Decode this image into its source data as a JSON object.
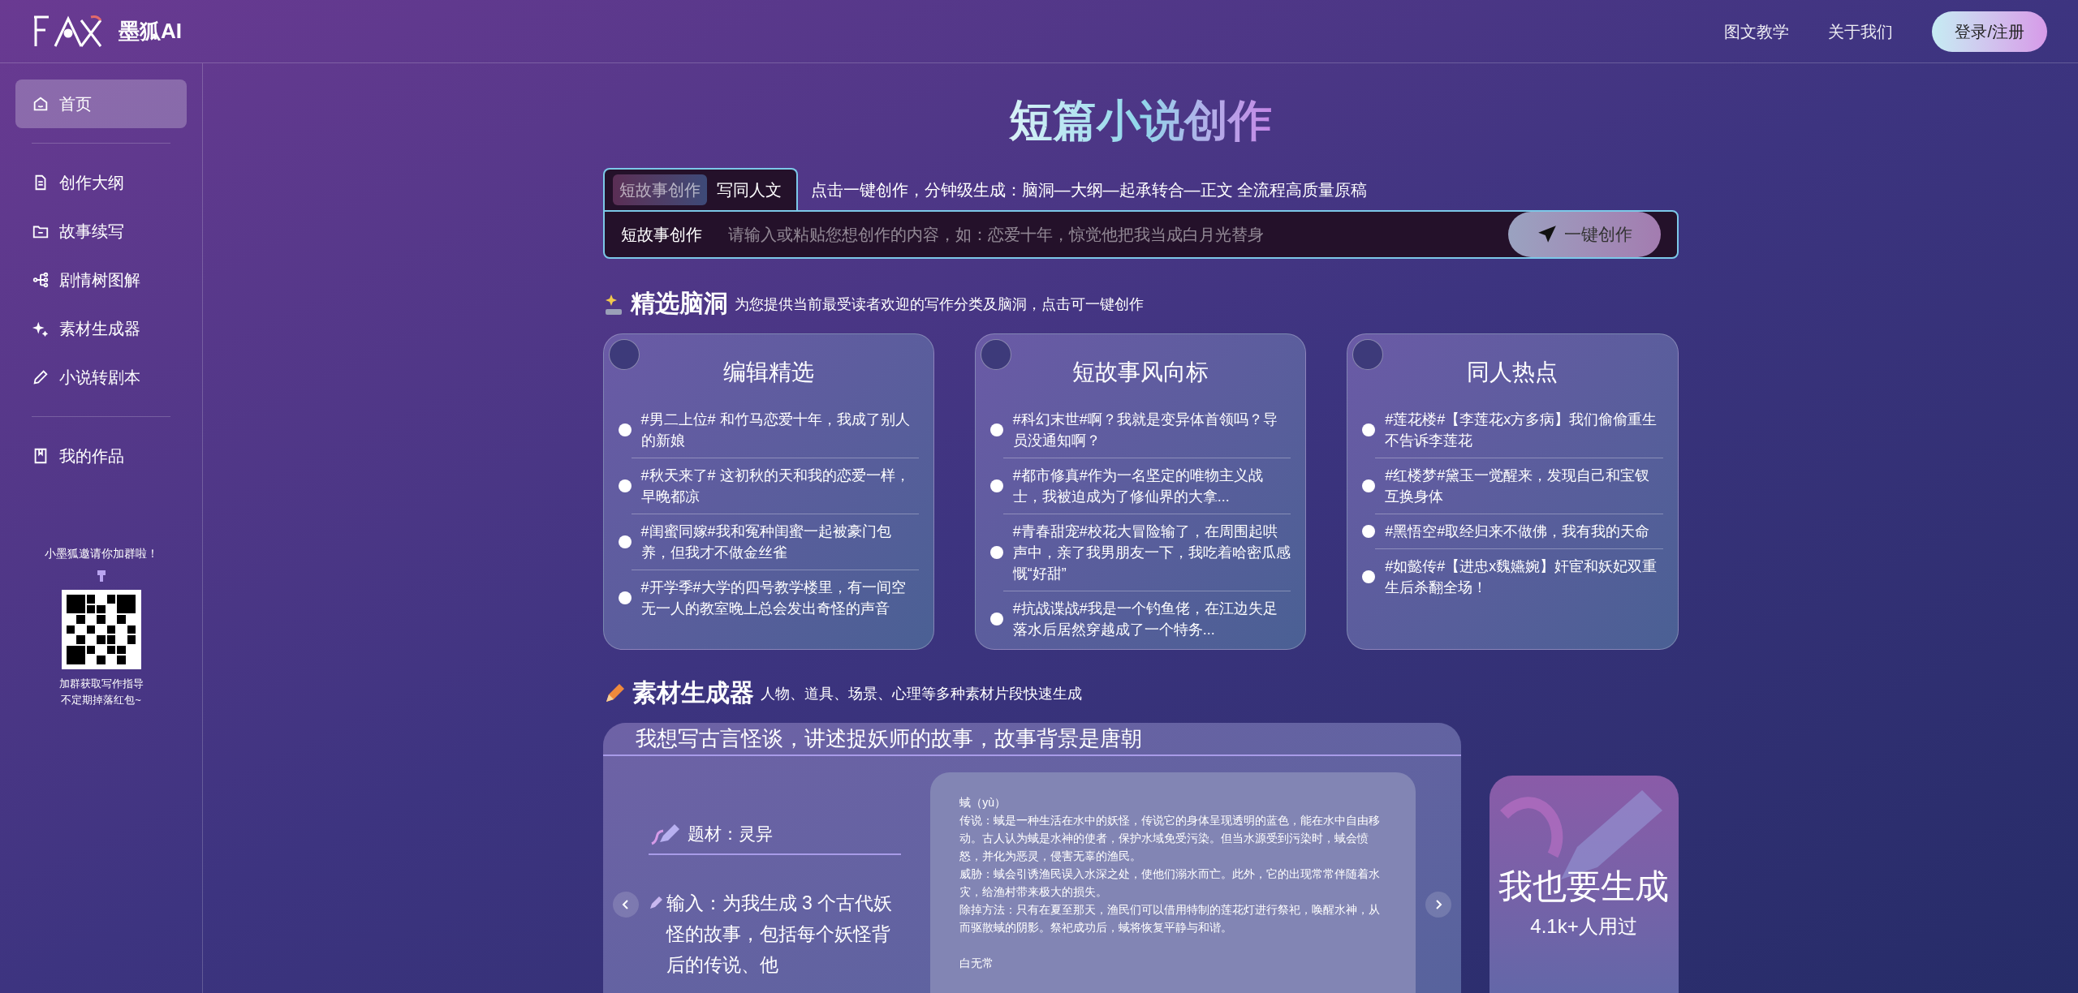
{
  "header": {
    "logo_text": "墨狐AI",
    "nav": [
      "图文教学",
      "关于我们"
    ],
    "login_button": "登录/注册"
  },
  "sidebar": {
    "groups": [
      [
        {
          "label": "首页",
          "selected": true
        }
      ],
      [
        {
          "label": "创作大纲",
          "selected": false
        },
        {
          "label": "故事续写",
          "selected": false
        },
        {
          "label": "剧情树图解",
          "selected": false
        },
        {
          "label": "素材生成器",
          "selected": false
        },
        {
          "label": "小说转剧本",
          "selected": false
        }
      ],
      [
        {
          "label": "我的作品",
          "selected": false
        }
      ]
    ],
    "invite": "小墨狐邀请你加群啦！",
    "qr_caption": [
      "加群获取写作指导",
      "不定期掉落红包~"
    ]
  },
  "main": {
    "title": "短篇小说创作",
    "tabs": [
      {
        "label": "短故事创作",
        "selected": true
      },
      {
        "label": "写同人文",
        "selected": false
      }
    ],
    "tagline": "点击一键创作，分钟级生成：脑洞—大纲—起承转合—正文 全流程高质量原稿",
    "input": {
      "label": "短故事创作",
      "placeholder": "请输入或粘贴您想创作的内容，如：恋爱十年，惊觉他把我当成白月光替身",
      "button": "一键创作"
    },
    "ideas": {
      "title": "精选脑洞",
      "subtitle": "为您提供当前最受读者欢迎的写作分类及脑洞，点击可一键创作",
      "cards": [
        {
          "title": "编辑精选",
          "items": [
            "#男二上位# 和竹马恋爱十年，我成了别人的新娘",
            "#秋天来了# 这初秋的天和我的恋爱一样，早晚都凉",
            "#闺蜜同嫁#我和冤种闺蜜一起被豪门包养，但我才不做金丝雀",
            "#开学季#大学的四号教学楼里，有一间空无一人的教室晚上总会发出奇怪的声音"
          ]
        },
        {
          "title": "短故事风向标",
          "items": [
            "#科幻末世#啊？我就是变异体首领吗？导员没通知啊？",
            "#都市修真#作为一名坚定的唯物主义战士，我被迫成为了修仙界的大拿...",
            "#青春甜宠#校花大冒险输了，在周围起哄声中，亲了我男朋友一下，我吃着哈密瓜感慨“好甜”",
            "#抗战谍战#我是一个钓鱼佬，在江边失足落水后居然穿越成了一个特务..."
          ]
        },
        {
          "title": "同人热点",
          "items": [
            "#莲花楼#【李莲花x方多病】我们偷偷重生不告诉李莲花",
            "#红楼梦#黛玉一觉醒来，发现自己和宝钗互换身体",
            "#黑悟空#取经归来不做佛，我有我的天命",
            "#如懿传#【进忠x魏嬿婉】奸宦和妖妃双重生后杀翻全场！"
          ]
        }
      ]
    },
    "materials": {
      "title": "素材生成器",
      "subtitle": "人物、道具、场景、心理等多种素材片段快速生成",
      "prompt": "我想写古言怪谈，讲述捉妖师的故事，故事背景是唐朝",
      "topic": "题材：灵异",
      "input_text": "输入：为我生成 3 个古代妖怪的故事，包括每个妖怪背后的传说、他",
      "output": [
        "蜮（yù）",
        "传说：蜮是一种生活在水中的妖怪，传说它的身体呈现透明的蓝色，能在水中自由移动。古人认为蜮是水神的使者，保护水域免受污染。但当水源受到污染时，蜮会愤怒，并化为恶灵，侵害无辜的渔民。",
        "威胁：蜮会引诱渔民误入水深之处，使他们溺水而亡。此外，它的出现常常伴随着水灾，给渔村带来极大的损失。",
        "除掉方法：只有在夏至那天，渔民们可以借用特制的莲花灯进行祭祀，唤醒水神，从而驱散蜮的阴影。祭祀成功后，蜮将恢复平静与和谐。",
        "白无常"
      ],
      "cta": {
        "title": "我也要生成",
        "users": "4.1k+人用过"
      }
    }
  }
}
